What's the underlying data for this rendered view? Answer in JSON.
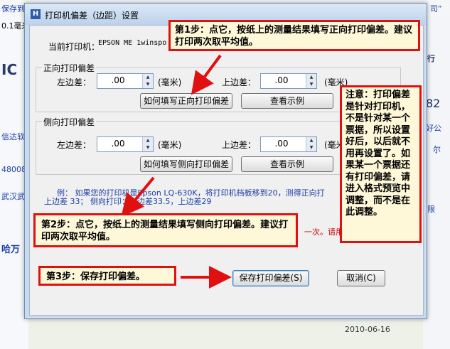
{
  "background": {
    "top_left_text": "保存到",
    "top_right_text": "”“ 司”",
    "left_texts": [
      "0.1毫米",
      "IC",
      "信达软",
      "48008",
      "武汉武",
      "哈万",
      "2010-06-16"
    ],
    "right_texts": [
      "行",
      "82",
      "好公",
      "尔",
      "限"
    ]
  },
  "dialog": {
    "title": "打印机偏差（边距）设置",
    "current_printer_label": "当前打印机：",
    "current_printer_value": "EPSON ME 1winspo",
    "forward": {
      "group_title": "正向打印偏差",
      "left_label": "左边差：",
      "left_value": ".00",
      "left_unit": "(毫米)",
      "top_label": "上边差：",
      "top_value": ".00",
      "top_unit": "(毫米)",
      "howto_button": "如何填写正向打印偏差",
      "example_button": "查看示例"
    },
    "side": {
      "group_title": "侧向打印偏差",
      "left_label": "左边差：",
      "left_value": ".00",
      "left_unit": "(毫米)",
      "top_label": "上边差：",
      "top_value": ".00",
      "top_unit": "(毫米)",
      "howto_button": "如何填写侧向打印偏差",
      "example_button": "查看示例"
    },
    "example_line1": "例：   如果您的打印机是Epson LQ-630K，将打印机档板移到20，测得正向打",
    "example_line2": "上边差 33；     侧向打印：左边差33.5，上边差29",
    "red_note": "一次。请用",
    "save_button": "保存打印偏差(S)",
    "cancel_button": "取消(C)"
  },
  "callouts": {
    "step1": "第1步：点它，按纸上的测量结果填写正向打印偏差。建议打印两次取平均值。",
    "step2": "第2步：点它，按纸上的测量结果填写侧向打印偏差。建议打印两次取平均值。",
    "step3": "第3步：保存打印偏差。",
    "note": "注意：打印偏差是针对打印机，不是针对某一个票据，所以设置好后，以后就不用再设置了。如果某一个票据还有打印偏差，请进入格式预览中调整，而不是在此调整。"
  }
}
